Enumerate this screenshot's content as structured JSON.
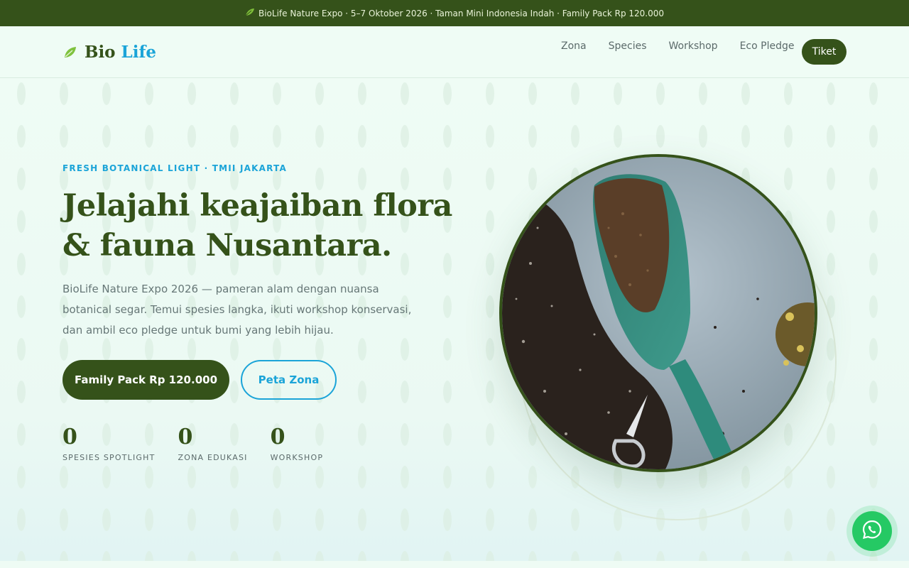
{
  "announcement": {
    "text": "BioLife Nature Expo · 5–7 Oktober 2026 · Taman Mini Indonesia Indah · Family Pack Rp 120.000",
    "icon": "leaf-icon"
  },
  "brand": {
    "name_part1": "Bio",
    "name_part2": "Life",
    "icon": "leaf-logo-icon",
    "primary_color": "#35521a",
    "accent_color": "#1ba4d8"
  },
  "nav": {
    "items": [
      {
        "label": "Zona"
      },
      {
        "label": "Species"
      },
      {
        "label": "Workshop"
      },
      {
        "label": "Eco Pledge"
      }
    ],
    "cta_label": "Tiket"
  },
  "hero": {
    "eyebrow": "FRESH BOTANICAL LIGHT · TMII JAKARTA",
    "headline_line1": "Jelajahi keajaiban flora",
    "headline_line2": "& fauna Nusantara.",
    "lead": "BioLife Nature Expo 2026 — pameran alam dengan nuansa botanical segar. Temui spesies langka, ikuti workshop konservasi, dan ambil eco pledge untuk bumi yang lebih hijau.",
    "primary_button": "Family Pack Rp 120.000",
    "secondary_button": "Peta Zona",
    "image_subject": "garden-trowel-with-soil-photo"
  },
  "stats": [
    {
      "value": "0",
      "label": "SPESIES SPOTLIGHT"
    },
    {
      "value": "0",
      "label": "ZONA EDUKASI"
    },
    {
      "value": "0",
      "label": "WORKSHOP"
    }
  ],
  "whatsapp": {
    "icon": "whatsapp-icon",
    "color": "#25c964"
  }
}
